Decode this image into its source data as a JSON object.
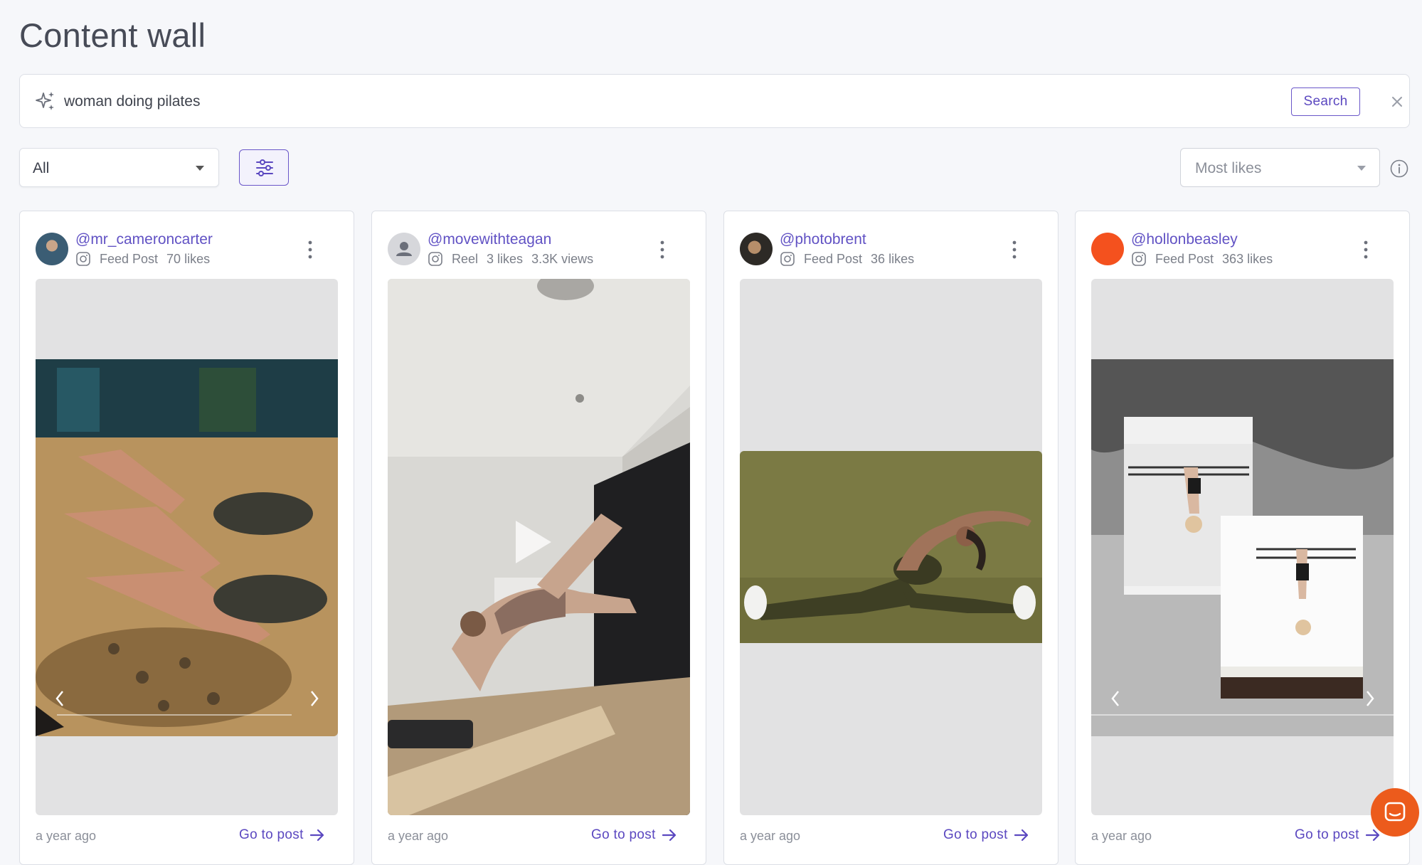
{
  "page": {
    "title": "Content wall"
  },
  "search": {
    "value": "woman doing pilates",
    "button_label": "Search"
  },
  "filters": {
    "type_value": "All",
    "sort_placeholder": "Most likes"
  },
  "colors": {
    "accent": "#5b48c0",
    "background": "#f6f7fa",
    "chat_launcher": "#ec5b1c"
  },
  "cards": [
    {
      "handle": "@mr_cameroncarter",
      "post_type": "Feed Post",
      "likes": "70 likes",
      "views": "",
      "time": "a year ago",
      "link_label": "Go to post"
    },
    {
      "handle": "@movewithteagan",
      "post_type": "Reel",
      "likes": "3 likes",
      "views": "3.3K views",
      "time": "a year ago",
      "link_label": "Go to post"
    },
    {
      "handle": "@photobrent",
      "post_type": "Feed Post",
      "likes": "36 likes",
      "views": "",
      "time": "a year ago",
      "link_label": "Go to post"
    },
    {
      "handle": "@hollonbeasley",
      "post_type": "Feed Post",
      "likes": "363 likes",
      "views": "",
      "time": "a year ago",
      "link_label": "Go to post"
    }
  ]
}
